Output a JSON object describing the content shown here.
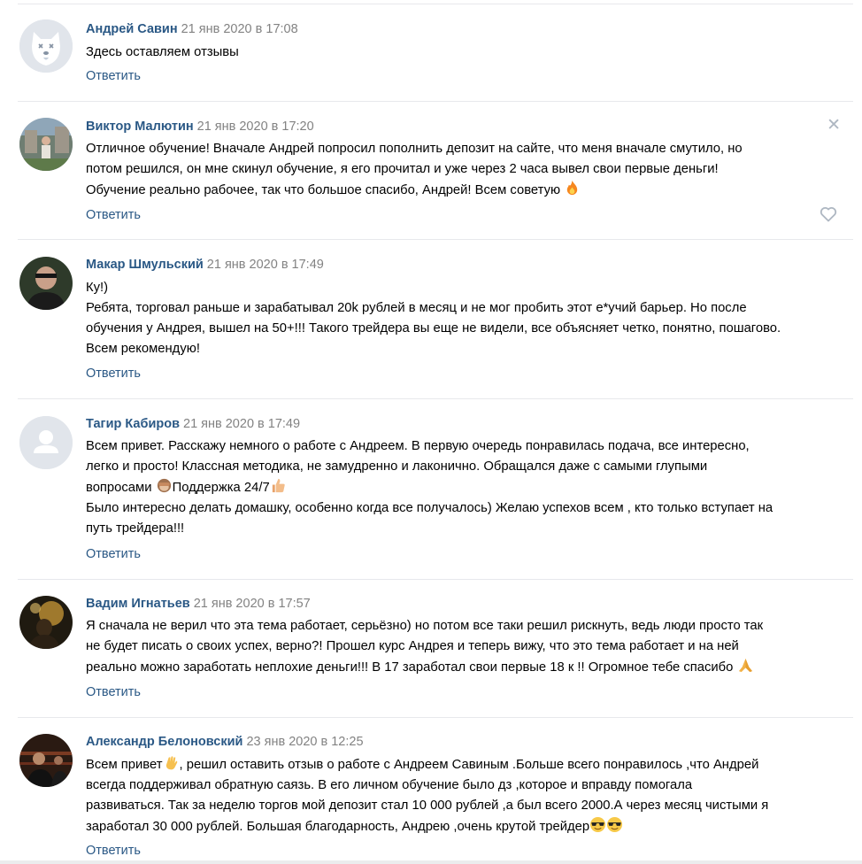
{
  "reply_label": "Ответить",
  "comments": [
    {
      "author": "Андрей Савин",
      "date": "21 янв 2020 в 17:08",
      "text": "Здесь оставляем отзывы",
      "avatar": "dog-placeholder-icon"
    },
    {
      "author": "Виктор Малютин",
      "date": "21 янв 2020 в 17:20",
      "text_parts": [
        "Отличное обучение! Вначале Андрей попросил пополнить депозит на сайте, что меня вначале смутило, но\nпотом решился, он мне скинул обучение, я его прочитал и уже через 2 часа вывел свои первые деньги!\nОбучение реально рабочее, так что большое спасибо, Андрей! Всем советую "
      ],
      "emoji": [
        "fire-emoji"
      ],
      "close_glyph": "✕"
    },
    {
      "author": "Макар Шмульский",
      "date": "21 янв 2020 в 17:49",
      "text": "Ку!)\nРебята, торговал раньше и зарабатывал 20k рублей в месяц и не мог пробить этот е*учий барьер. Но после\nобучения у Андрея, вышел на 50+!!! Такого трейдера вы еще не видели, все объясняет четко, понятно, пошагово.\nВсем рекомендую!"
    },
    {
      "author": "Тагир Кабиров",
      "date": "21 янв 2020 в 17:49",
      "text_parts": [
        "Всем привет. Расскажу немного о работе с Андреем. В первую очередь понравилась подача, все интересно,\nлегко и просто! Классная методика, не замудренно и лаконично. Обращался даже с самыми глупыми\nвопросами ",
        "Поддержка 24/7",
        "\nБыло интересно делать домашку, особенно когда все получалось) Желаю успехов всем , кто только вступает на\nпуть трейдера!!!"
      ],
      "emoji": [
        "monkey-emoji",
        "thumbs-up-emoji"
      ],
      "avatar": "default-user-icon"
    },
    {
      "author": "Вадим Игнатьев",
      "date": "21 янв 2020 в 17:57",
      "text_parts": [
        "Я сначала не верил что эта тема работает, серьёзно) но потом все таки решил рискнуть, ведь люди просто так\nне будет писать о своих успех, верно?! Прошел курс Андрея и теперь вижу, что это тема работает и на ней\nреально можно заработать неплохие деньги!!! В 17 заработал свои первые 18 к !! Огромное тебе спасибо "
      ],
      "emoji": [
        "praying-hands-emoji"
      ]
    },
    {
      "author": "Александр Белоновский",
      "date": "23 янв 2020 в 12:25",
      "text_parts": [
        "Всем привет",
        ", решил оставить отзыв о работе с Андреем Савиным .Больше всего понравилось ,что Андрей\nвсегда поддерживал обратную саязь. В его личном обучение было дз ,которое и вправду помогала\nразвиваться. Так за неделю торгов мой депозит стал 10 000 рублей ,а был всего 2000.А через месяц чистыми я\nзаработал 30 000 рублей. Большая благодарность, Андрею ,очень крутой трейдер"
      ],
      "emoji": [
        "waving-hand-emoji",
        "sunglasses-emoji",
        "sunglasses-emoji"
      ]
    }
  ],
  "colors": {
    "link": "#2a5885",
    "date": "#828282",
    "separator": "#e7e8ec",
    "icon_muted": "#aeb7c2"
  }
}
